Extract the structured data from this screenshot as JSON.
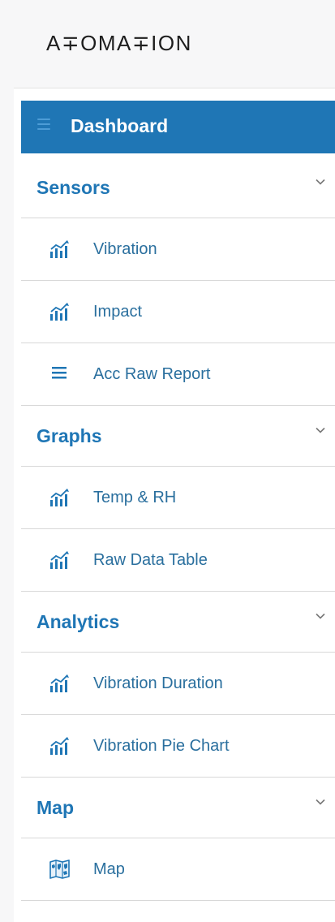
{
  "brand": {
    "logo_text": "A∓OMA∓ION"
  },
  "sidebar": {
    "dashboard": {
      "label": "Dashboard"
    },
    "sections": [
      {
        "label": "Sensors",
        "items": [
          {
            "label": "Vibration",
            "icon": "bar-chart-icon"
          },
          {
            "label": "Impact",
            "icon": "bar-chart-icon"
          },
          {
            "label": "Acc Raw Report",
            "icon": "list-icon"
          }
        ]
      },
      {
        "label": "Graphs",
        "items": [
          {
            "label": "Temp & RH",
            "icon": "bar-chart-icon"
          },
          {
            "label": "Raw Data Table",
            "icon": "bar-chart-icon"
          }
        ]
      },
      {
        "label": "Analytics",
        "items": [
          {
            "label": "Vibration Duration",
            "icon": "bar-chart-icon"
          },
          {
            "label": "Vibration Pie Chart",
            "icon": "bar-chart-icon"
          }
        ]
      },
      {
        "label": "Map",
        "items": [
          {
            "label": "Map",
            "icon": "map-icon"
          }
        ]
      }
    ]
  },
  "colors": {
    "accent": "#1f76b5",
    "item_text": "#2a6f9e",
    "divider": "#d8d8d8",
    "logo_bar_bg": "#f7f7f8"
  }
}
